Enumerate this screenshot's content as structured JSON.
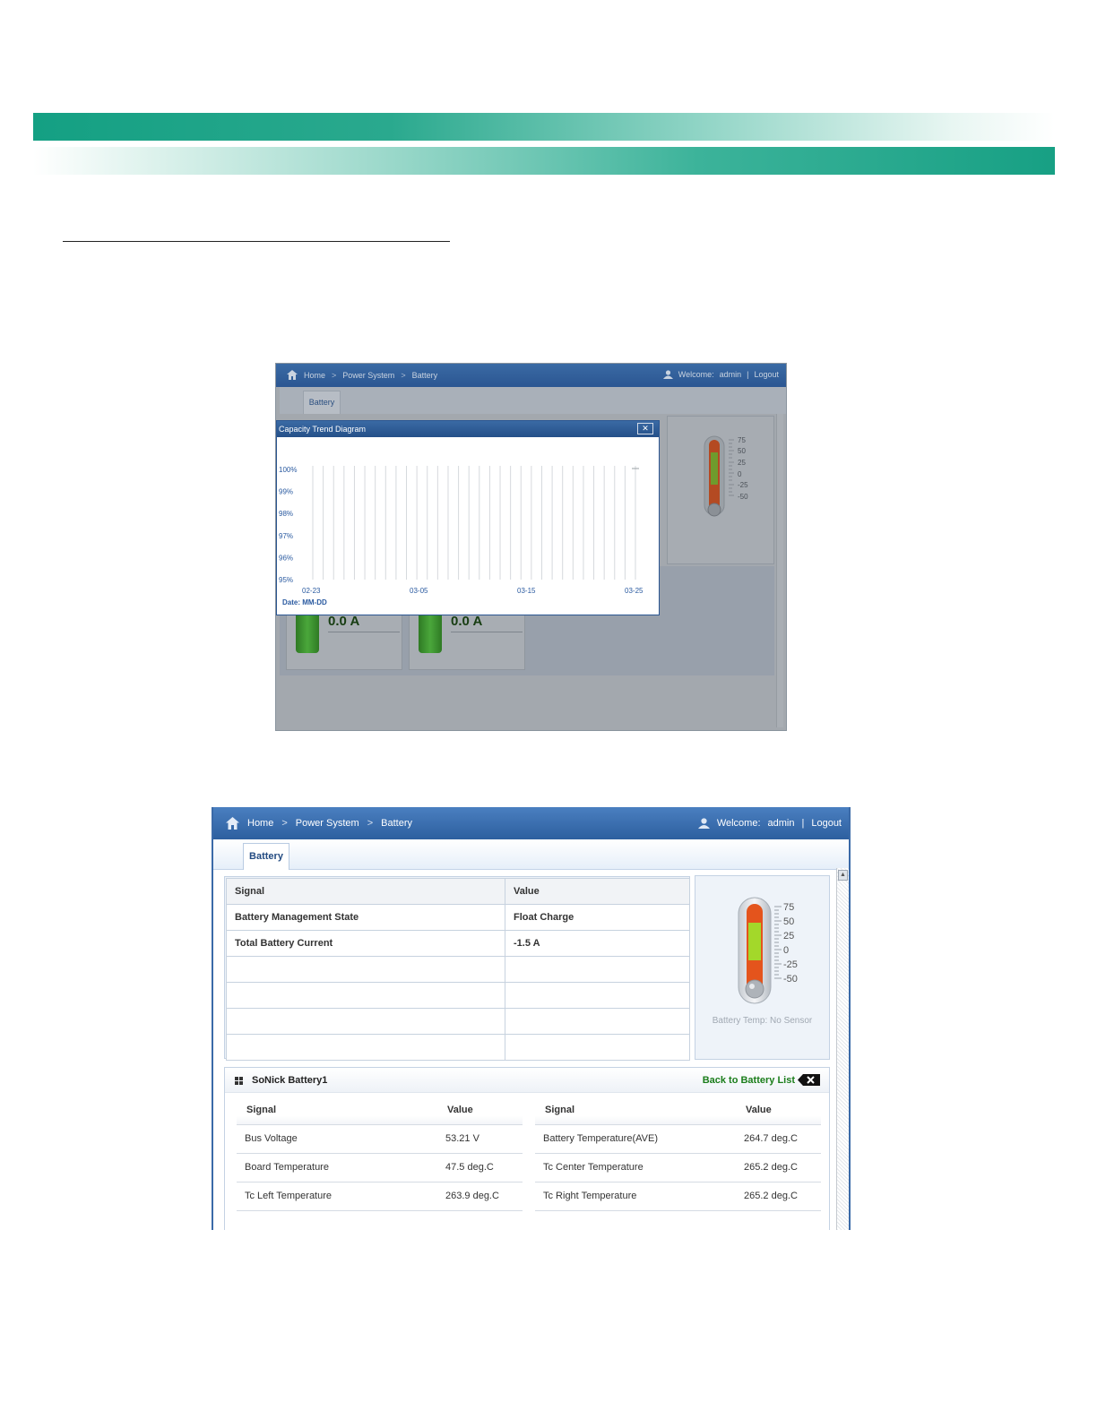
{
  "screenshot1": {
    "breadcrumb": {
      "home": "Home",
      "power_system": "Power System",
      "battery": "Battery"
    },
    "user": {
      "welcome": "Welcome:",
      "name": "admin",
      "separator": "|",
      "logout": "Logout"
    },
    "tab": "Battery",
    "dialog": {
      "title": "Capacity Trend Diagram",
      "close": "✕",
      "y_ticks": [
        "100%",
        "99%",
        "98%",
        "97%",
        "96%",
        "95%"
      ],
      "x_ticks": [
        "02-23",
        "03-05",
        "03-15",
        "03-25"
      ],
      "x_caption": "Date: MM-DD"
    },
    "thermometer_scale": [
      "75",
      "50",
      "25",
      "0",
      "-25",
      "-50"
    ],
    "cards": [
      {
        "value": "0.0 A"
      },
      {
        "value": "0.0 A"
      }
    ]
  },
  "screenshot2": {
    "breadcrumb": {
      "home": "Home",
      "power_system": "Power System",
      "battery": "Battery"
    },
    "user": {
      "welcome": "Welcome:",
      "name": "admin",
      "separator": "|",
      "logout": "Logout"
    },
    "tab": "Battery",
    "signal_table": {
      "headers": [
        "Signal",
        "Value"
      ],
      "rows": [
        [
          "Battery Management State",
          "Float Charge"
        ],
        [
          "Total Battery Current",
          "-1.5 A"
        ]
      ]
    },
    "thermometer_scale": [
      "75",
      "50",
      "25",
      "0",
      "-25",
      "-50"
    ],
    "thermometer_label": "Battery Temp: No Sensor",
    "battery_panel": {
      "title": "SoNick Battery1",
      "back_label": "Back to Battery List",
      "left": {
        "headers": [
          "Signal",
          "Value"
        ],
        "rows": [
          [
            "Bus Voltage",
            "53.21 V"
          ],
          [
            "Board Temperature",
            "47.5 deg.C"
          ],
          [
            "Tc Left Temperature",
            "263.9 deg.C"
          ]
        ]
      },
      "right": {
        "headers": [
          "Signal",
          "Value"
        ],
        "rows": [
          [
            "Battery Temperature(AVE)",
            "264.7 deg.C"
          ],
          [
            "Tc Center Temperature",
            "265.2 deg.C"
          ],
          [
            "Tc Right Temperature",
            "265.2 deg.C"
          ]
        ]
      }
    }
  },
  "colors": {
    "header_blue": "#2d5f9f",
    "accent_green": "#17a084",
    "back_link_green": "#1a7d1a"
  },
  "icons": [
    "home-icon",
    "chevron-right-icon",
    "user-icon",
    "close-icon",
    "thermometer-icon",
    "grid-icon",
    "back-delete-icon",
    "scroll-up-arrow-icon"
  ]
}
